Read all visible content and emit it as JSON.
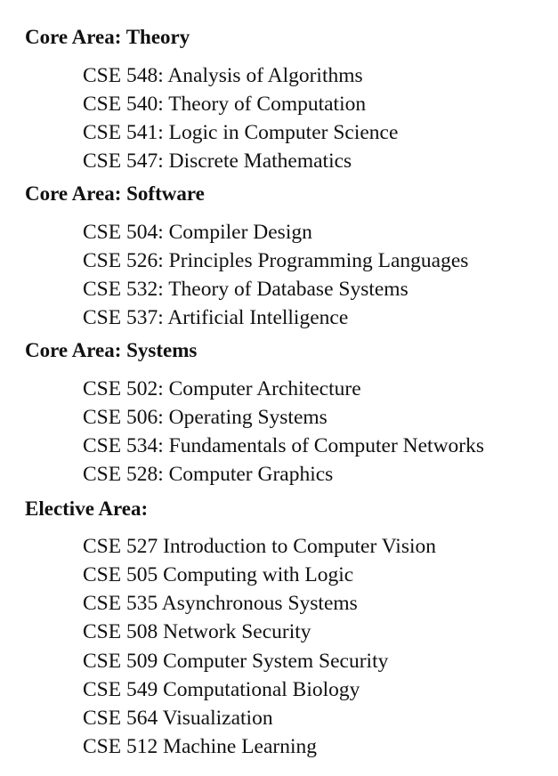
{
  "sections": [
    {
      "title": "Core Area: Theory",
      "courses": [
        "CSE 548: Analysis of Algorithms",
        "CSE 540: Theory of Computation",
        "CSE 541: Logic in Computer Science",
        "CSE 547: Discrete Mathematics"
      ]
    },
    {
      "title": "Core Area: Software",
      "courses": [
        "CSE 504: Compiler Design",
        "CSE 526: Principles Programming Languages",
        "CSE 532: Theory of Database Systems",
        "CSE 537: Artificial Intelligence"
      ]
    },
    {
      "title": "Core Area: Systems",
      "courses": [
        "CSE 502: Computer Architecture",
        "CSE 506: Operating Systems",
        "CSE 534: Fundamentals of Computer Networks",
        "CSE 528: Computer Graphics"
      ]
    },
    {
      "title": "Elective Area:",
      "courses": [
        "CSE 527 Introduction to Computer Vision",
        "CSE 505 Computing with Logic",
        "CSE 535 Asynchronous Systems",
        "CSE 508 Network Security",
        "CSE 509 Computer System Security",
        "CSE 549 Computational Biology",
        "CSE 564 Visualization",
        "CSE 512 Machine Learning"
      ]
    }
  ]
}
